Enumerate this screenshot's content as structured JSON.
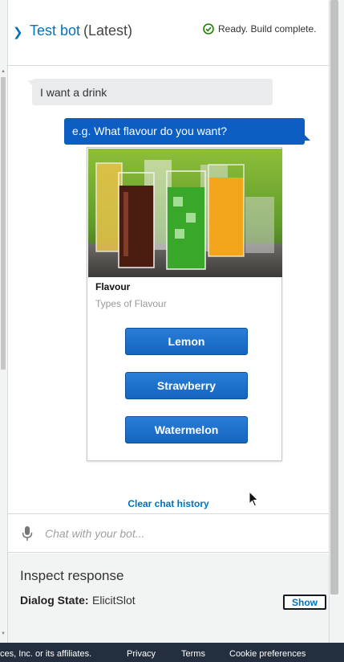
{
  "header": {
    "title": "Test bot",
    "version": "(Latest)",
    "status": "Ready. Build complete."
  },
  "chat": {
    "user_message": "I want a drink",
    "bot_message": "e.g. What flavour do you want?",
    "card": {
      "title": "Flavour",
      "subtitle": "Types of Flavour",
      "buttons": [
        "Lemon",
        "Strawberry",
        "Watermelon"
      ]
    },
    "clear_history": "Clear chat history"
  },
  "input": {
    "placeholder": "Chat with your bot..."
  },
  "inspect": {
    "title": "Inspect response",
    "dialog_state_label": "Dialog State:",
    "dialog_state_value": "ElicitSlot",
    "show_label": "Show"
  },
  "footer": {
    "copyright": "ces, Inc. or its affiliates.",
    "links": [
      "Privacy",
      "Terms",
      "Cookie preferences"
    ]
  },
  "colors": {
    "accent": "#0073bb",
    "bot_bubble": "#0d5ec2",
    "button": "#1465c0",
    "success": "#1d8102",
    "footer_bg": "#232f3e"
  }
}
